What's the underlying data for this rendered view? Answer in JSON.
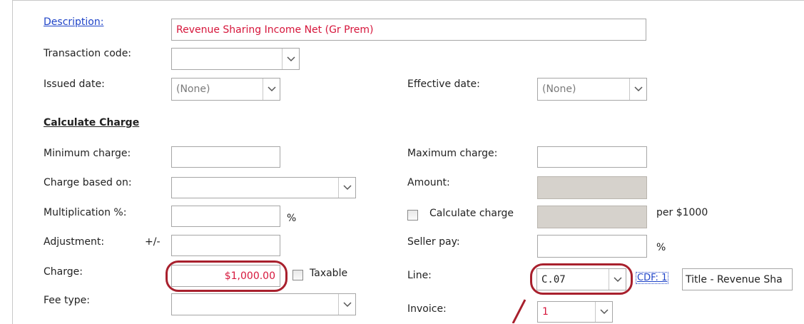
{
  "form": {
    "description_label": "Description:",
    "description_value": "Revenue Sharing Income Net (Gr Prem)",
    "transaction_code_label": "Transaction code:",
    "transaction_code_value": "",
    "issued_date_label": "Issued date:",
    "issued_date_value": "(None)",
    "effective_date_label": "Effective date:",
    "effective_date_value": "(None)"
  },
  "calc": {
    "section_title": "Calculate Charge",
    "minimum_charge_label": "Minimum charge:",
    "minimum_charge_value": "",
    "maximum_charge_label": "Maximum charge:",
    "maximum_charge_value": "",
    "charge_based_on_label": "Charge based on:",
    "charge_based_on_value": "",
    "amount_label": "Amount:",
    "multiplication_label": "Multiplication %:",
    "multiplication_value": "",
    "percent_symbol": "%",
    "calculate_charge_label": "Calculate charge",
    "calculate_charge_checked": false,
    "per_1000_label": "per $1000",
    "adjustment_label": "Adjustment:",
    "adjustment_sign": "+/-",
    "adjustment_value": "",
    "seller_pay_label": "Seller pay:",
    "seller_pay_value": "",
    "seller_pay_percent": "%",
    "charge_label": "Charge:",
    "charge_value": "$1,000.00",
    "taxable_label": "Taxable",
    "taxable_checked": false,
    "line_label": "Line:",
    "line_value": "C.07",
    "cdf_link": "CDF: 1",
    "cdf_title_value": "Title - Revenue Sha",
    "fee_type_label": "Fee type:",
    "fee_type_value": "",
    "invoice_label": "Invoice:",
    "invoice_value": "1"
  },
  "colors": {
    "highlight_ring": "#a8202d",
    "value_red": "#d6163b",
    "link_blue": "#1f44c8",
    "readonly_fill": "#d6d2cc"
  }
}
